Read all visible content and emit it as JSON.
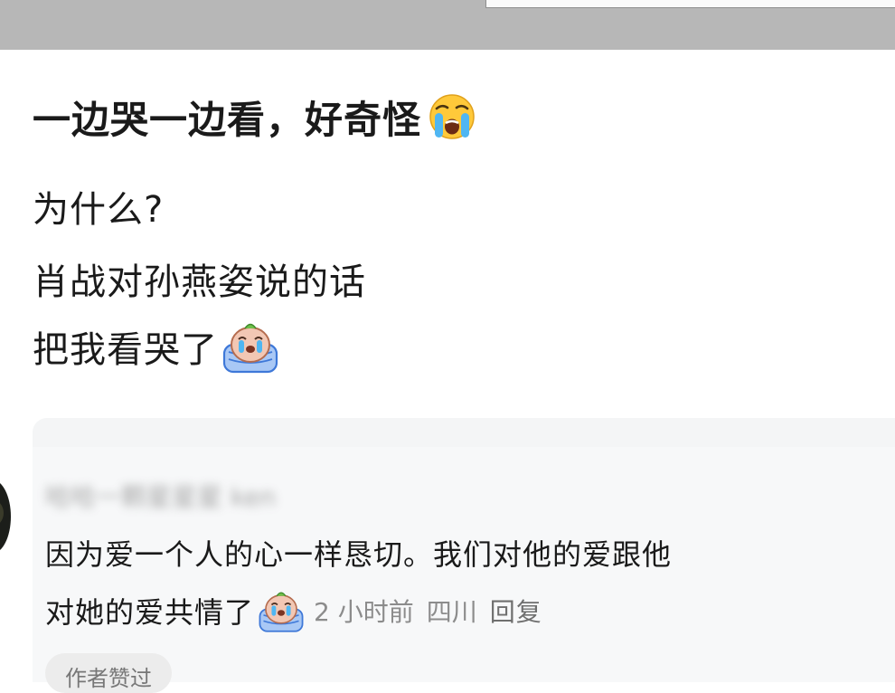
{
  "post": {
    "title": "一边哭一边看，好奇怪",
    "title_emoji": "loudly-crying-face-icon",
    "lines": [
      "为什么?",
      "肖战对孙燕姿说的话",
      "把我看哭了"
    ],
    "line_emoji": "crying-sticker-icon"
  },
  "comment": {
    "username": "哈哈一颗星星星 ken",
    "text_line_1": "因为爱一个人的心一样恳切。我们对他的爱跟他",
    "text_line_2": "对她的爱共情了",
    "text_emoji": "crying-sticker-icon",
    "time": "2 小时前",
    "location": "四川",
    "reply_label": "回复",
    "author_tag": "作者赞过"
  },
  "colors": {
    "top_bar": "#b7b7b7",
    "comment_bg": "#f7f8f9",
    "meta_text": "#8c8c8c"
  }
}
